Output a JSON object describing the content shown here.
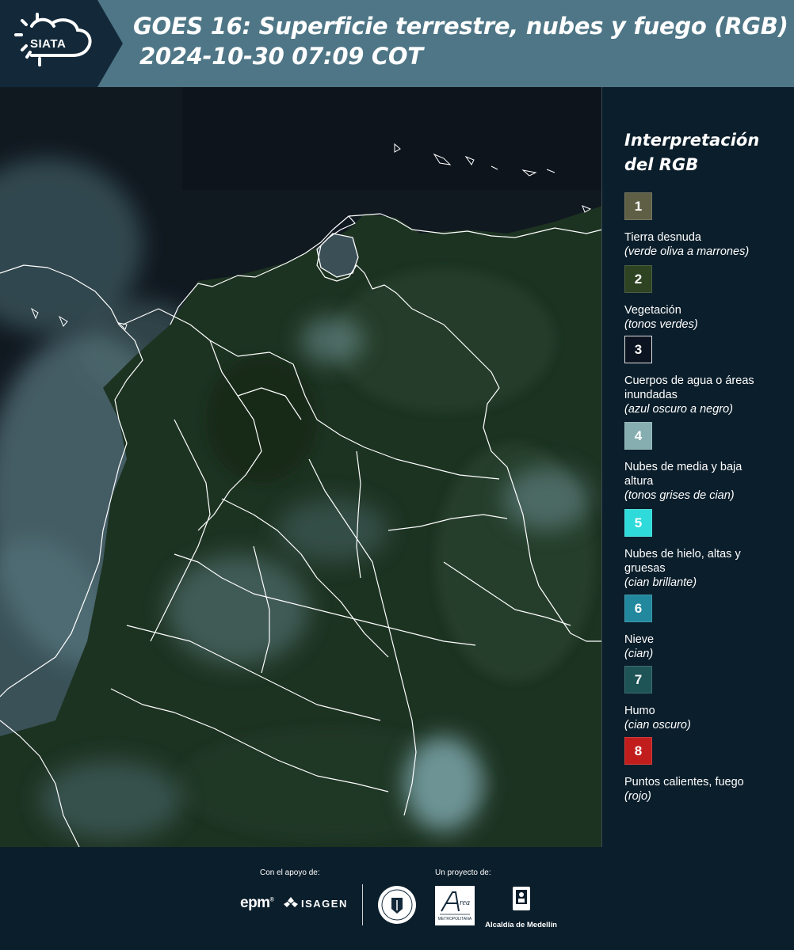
{
  "header": {
    "logo_text": "SIATA",
    "title_line1": "GOES 16: Superficie terrestre, nubes y fuego (RGB)",
    "title_line2": "2024-10-30 07:09 COT",
    "background": "#4e7686"
  },
  "map": {
    "description_icon": "satellite-rgb-composite",
    "land_color": "#1c3424",
    "water_color": "#0e141c",
    "cloud_color": "#7fa6ad",
    "border_color": "#ffffff"
  },
  "legend": {
    "title_line1": "Interpretación",
    "title_line2": "del RGB",
    "items": [
      {
        "number": "1",
        "color": "#5f5f45",
        "label": "Tierra desnuda",
        "sub": "(verde oliva a marrones)"
      },
      {
        "number": "2",
        "color": "#2e4322",
        "label": "Vegetación",
        "sub": "(tonos verdes)"
      },
      {
        "number": "3",
        "color": "#0b1420",
        "label": "Cuerpos de agua o áreas inundadas",
        "sub": "(azul oscuro a negro)"
      },
      {
        "number": "4",
        "color": "#86aeb1",
        "label": "Nubes de media y baja altura",
        "sub": "(tonos grises de cian)"
      },
      {
        "number": "5",
        "color": "#2fdada",
        "label": "Nubes de hielo, altas y gruesas",
        "sub": "(cian brillante)"
      },
      {
        "number": "6",
        "color": "#21889e",
        "label": "Nieve",
        "sub": "(cian)"
      },
      {
        "number": "7",
        "color": "#1e5456",
        "label": "Humo",
        "sub": "(cian oscuro)"
      },
      {
        "number": "8",
        "color": "#c21d1d",
        "label": "Puntos calientes, fuego",
        "sub": "(rojo)"
      }
    ]
  },
  "footer": {
    "support_caption": "Con el apoyo de:",
    "project_caption": "Un proyecto de:",
    "epm_logo": "epm",
    "isagen_logo": "ISAGEN",
    "alcaldia_logo": "Alcaldía de Medellín",
    "area_logo": "Área Metropolitana Valle de Aburrá"
  }
}
